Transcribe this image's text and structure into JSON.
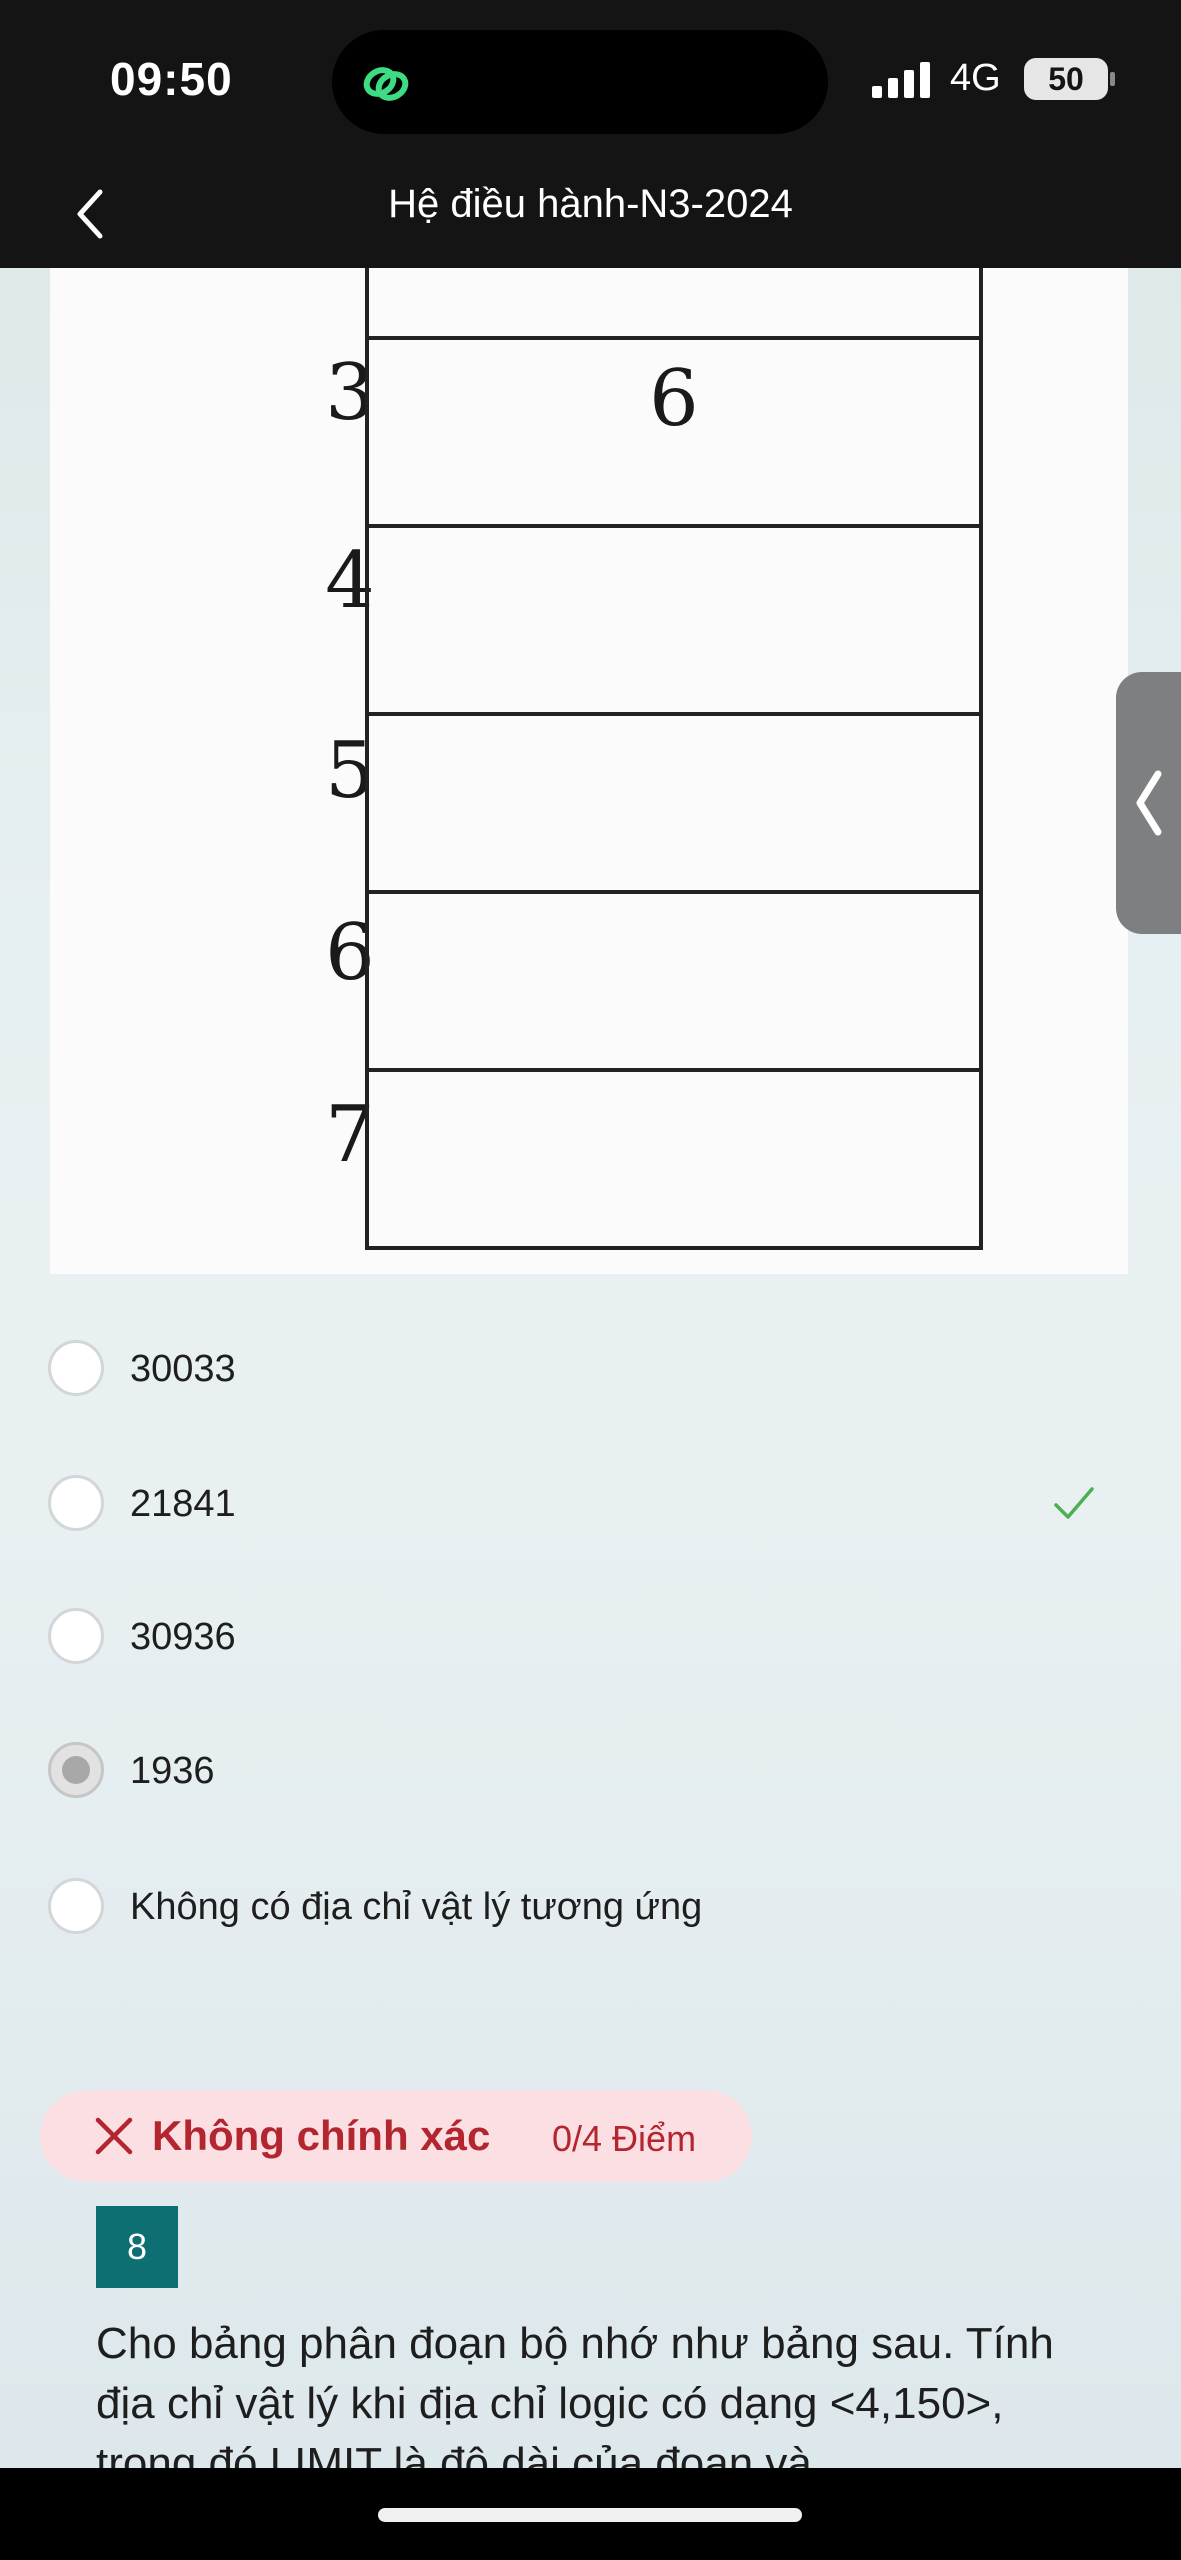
{
  "status_bar": {
    "time": "09:50",
    "network": "4G",
    "battery": "50"
  },
  "nav": {
    "title": "Hệ điều hành-N3-2024"
  },
  "segment_table": {
    "rows": [
      {
        "label": "3",
        "value": "6"
      },
      {
        "label": "4",
        "value": ""
      },
      {
        "label": "5",
        "value": ""
      },
      {
        "label": "6",
        "value": ""
      },
      {
        "label": "7",
        "value": ""
      }
    ]
  },
  "options": [
    {
      "label": "30033",
      "selected": false,
      "correct": false
    },
    {
      "label": "21841",
      "selected": false,
      "correct": true
    },
    {
      "label": "30936",
      "selected": false,
      "correct": false
    },
    {
      "label": "1936",
      "selected": true,
      "correct": false
    },
    {
      "label": "Không có địa chỉ vật lý tương ứng",
      "selected": false,
      "correct": false
    }
  ],
  "result": {
    "status": "Không chính xác",
    "score": "0/4 Điểm"
  },
  "next_question": {
    "number": "8",
    "text": "Cho bảng phân đoạn bộ nhớ như bảng sau.  Tính địa chỉ vật lý khi địa chỉ logic có dạng <4,150>, trong đó LIMIT là độ dài của đoạn và"
  },
  "colors": {
    "accent": "#0e6f73",
    "error": "#b3262f",
    "error_bg": "#fbdfe2",
    "correct": "#4caf50"
  }
}
